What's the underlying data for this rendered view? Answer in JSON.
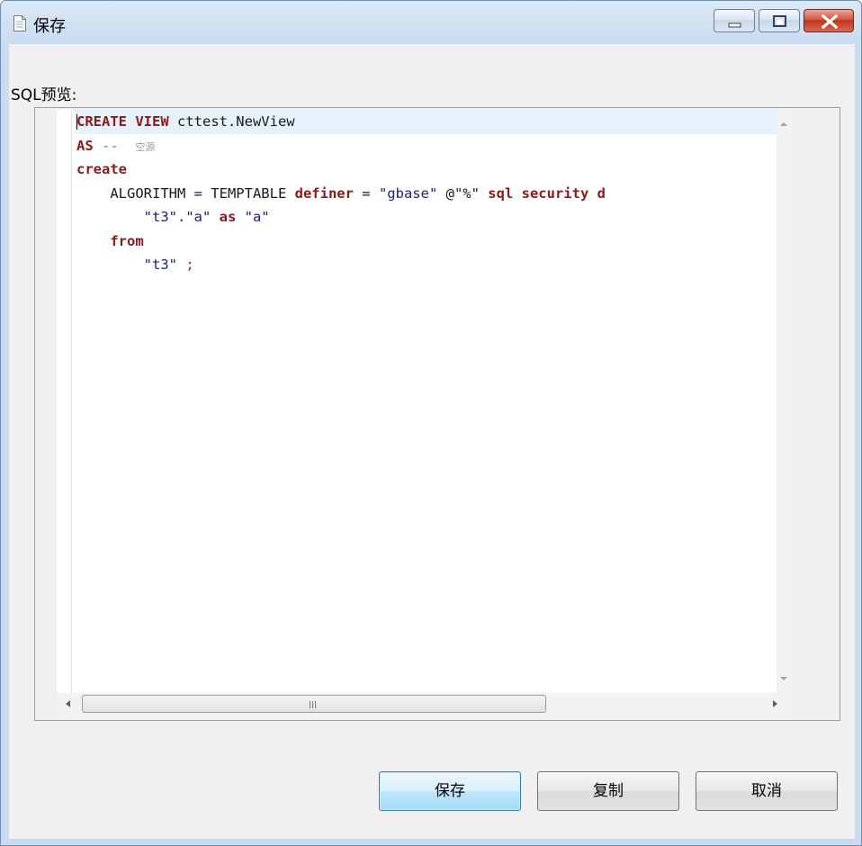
{
  "window": {
    "title": "保存"
  },
  "sql_preview": {
    "label": "SQL预览:",
    "lines": [
      {
        "indent": "",
        "tokens": [
          {
            "t": "CREATE VIEW",
            "c": "kw"
          },
          {
            "t": " cttest.NewView",
            "c": "id"
          }
        ]
      },
      {
        "indent": "",
        "tokens": [
          {
            "t": "AS",
            "c": "kw"
          },
          {
            "t": " --  ",
            "c": "comment"
          },
          {
            "t": "空源",
            "c": "comment-zh"
          }
        ]
      },
      {
        "indent": "",
        "tokens": [
          {
            "t": "create",
            "c": "kw"
          }
        ]
      },
      {
        "indent": "    ",
        "tokens": [
          {
            "t": "ALGORITHM = TEMPTABLE ",
            "c": "id"
          },
          {
            "t": "definer",
            "c": "kw"
          },
          {
            "t": " = ",
            "c": "id"
          },
          {
            "t": "\"gbase\"",
            "c": "str"
          },
          {
            "t": " @\"%\" ",
            "c": "id"
          },
          {
            "t": "sql security d",
            "c": "kw"
          }
        ]
      },
      {
        "indent": "        ",
        "tokens": [
          {
            "t": "\"t3\".\"a\"",
            "c": "str"
          },
          {
            "t": " as ",
            "c": "kw"
          },
          {
            "t": "\"a\"",
            "c": "str"
          }
        ]
      },
      {
        "indent": "    ",
        "tokens": [
          {
            "t": "from",
            "c": "kw"
          }
        ]
      },
      {
        "indent": "        ",
        "tokens": [
          {
            "t": "\"t3\"",
            "c": "str"
          },
          {
            "t": " ;",
            "c": "punct"
          }
        ]
      }
    ]
  },
  "buttons": {
    "save": "保存",
    "copy": "复制",
    "cancel": "取消"
  },
  "icons": {
    "title": "document-icon",
    "minimize": "minimize-icon",
    "maximize": "maximize-icon",
    "close": "close-icon"
  }
}
